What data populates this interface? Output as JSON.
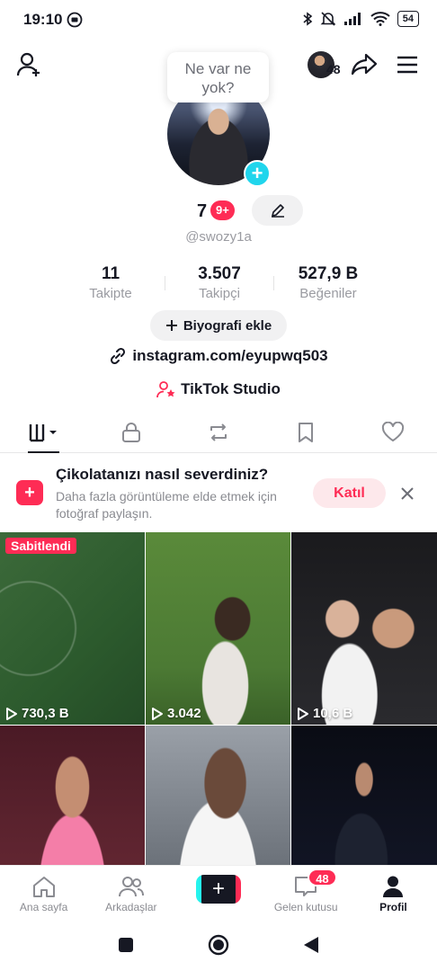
{
  "status_bar": {
    "time": "19:10",
    "battery": "54"
  },
  "header": {
    "avatar_count": "48"
  },
  "bubble": {
    "text_line1": "Ne var ne",
    "text_line2": "yok?"
  },
  "profile": {
    "nickname": "7",
    "notification_badge": "9+",
    "username": "@swozy1a",
    "stats": [
      {
        "value": "11",
        "label": "Takipte"
      },
      {
        "value": "3.507",
        "label": "Takipçi"
      },
      {
        "value": "527,9 B",
        "label": "Beğeniler"
      }
    ],
    "bio_button": "Biyografi ekle",
    "link": "instagram.com/eyupwq503",
    "studio": "TikTok Studio"
  },
  "promo": {
    "title": "Çikolatanızı nasıl severdiniz?",
    "text": "Daha fazla görüntüleme elde etmek için fotoğraf paylaşın.",
    "join_label": "Katıl"
  },
  "videos": [
    {
      "views": "730,3 B",
      "pinned_label": "Sabitlendi"
    },
    {
      "views": "3.042"
    },
    {
      "views": "10,6 B"
    },
    {
      "views": ""
    },
    {
      "views": ""
    },
    {
      "views": ""
    }
  ],
  "bottom_nav": {
    "home": "Ana sayfa",
    "friends": "Arkadaşlar",
    "inbox": "Gelen kutusu",
    "inbox_badge": "48",
    "profile": "Profil"
  },
  "colors": {
    "accent": "#fe2c55",
    "cyan": "#20d5ec",
    "text": "#161823",
    "muted": "#9a9ba1"
  }
}
